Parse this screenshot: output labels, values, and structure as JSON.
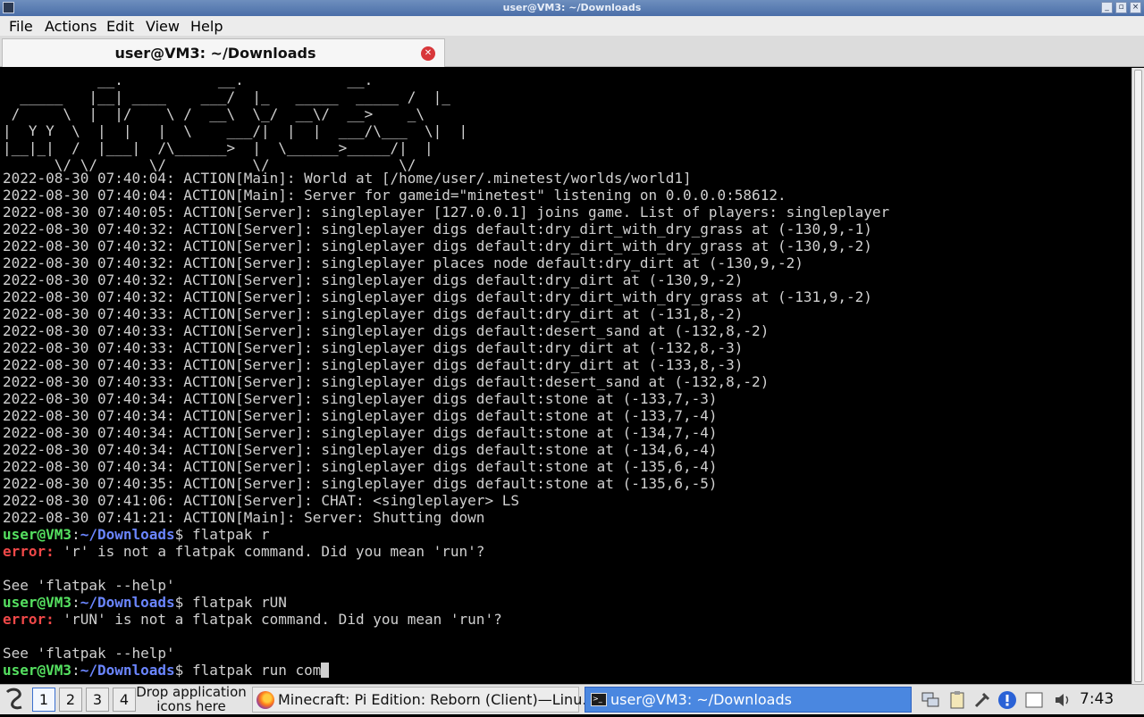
{
  "window": {
    "title": "user@VM3: ~/Downloads"
  },
  "menu": [
    "File",
    "Actions",
    "Edit",
    "View",
    "Help"
  ],
  "tab": {
    "label": "user@VM3: ~/Downloads"
  },
  "terminal": {
    "banner": [
      "           __.           __.            __.  ",
      "  _____   |__| ____    ___/  |_   _____  _____ /  |_ ",
      " /     \\  |  |/    \\ /  __\\  \\_/  __\\/  __>    _\\",
      "|  Y Y  \\  |  |   |  \\    ___/|  |  |  ___/\\___  \\|  |",
      "|__|_|  /  |___|  /\\______>  |  \\______>_____/|  |",
      "      \\/ \\/      \\/          \\/               \\/  "
    ],
    "log": [
      "2022-08-30 07:40:04: ACTION[Main]: World at [/home/user/.minetest/worlds/world1]",
      "2022-08-30 07:40:04: ACTION[Main]: Server for gameid=\"minetest\" listening on 0.0.0.0:58612.",
      "2022-08-30 07:40:05: ACTION[Server]: singleplayer [127.0.0.1] joins game. List of players: singleplayer",
      "2022-08-30 07:40:32: ACTION[Server]: singleplayer digs default:dry_dirt_with_dry_grass at (-130,9,-1)",
      "2022-08-30 07:40:32: ACTION[Server]: singleplayer digs default:dry_dirt_with_dry_grass at (-130,9,-2)",
      "2022-08-30 07:40:32: ACTION[Server]: singleplayer places node default:dry_dirt at (-130,9,-2)",
      "2022-08-30 07:40:32: ACTION[Server]: singleplayer digs default:dry_dirt at (-130,9,-2)",
      "2022-08-30 07:40:32: ACTION[Server]: singleplayer digs default:dry_dirt_with_dry_grass at (-131,9,-2)",
      "2022-08-30 07:40:33: ACTION[Server]: singleplayer digs default:dry_dirt at (-131,8,-2)",
      "2022-08-30 07:40:33: ACTION[Server]: singleplayer digs default:desert_sand at (-132,8,-2)",
      "2022-08-30 07:40:33: ACTION[Server]: singleplayer digs default:dry_dirt at (-132,8,-3)",
      "2022-08-30 07:40:33: ACTION[Server]: singleplayer digs default:dry_dirt at (-133,8,-3)",
      "2022-08-30 07:40:33: ACTION[Server]: singleplayer digs default:desert_sand at (-132,8,-2)",
      "2022-08-30 07:40:34: ACTION[Server]: singleplayer digs default:stone at (-133,7,-3)",
      "2022-08-30 07:40:34: ACTION[Server]: singleplayer digs default:stone at (-133,7,-4)",
      "2022-08-30 07:40:34: ACTION[Server]: singleplayer digs default:stone at (-134,7,-4)",
      "2022-08-30 07:40:34: ACTION[Server]: singleplayer digs default:stone at (-134,6,-4)",
      "2022-08-30 07:40:34: ACTION[Server]: singleplayer digs default:stone at (-135,6,-4)",
      "2022-08-30 07:40:35: ACTION[Server]: singleplayer digs default:stone at (-135,6,-5)",
      "2022-08-30 07:41:06: ACTION[Server]: CHAT: <singleplayer> LS",
      "2022-08-30 07:41:21: ACTION[Main]: Server: Shutting down"
    ],
    "prompt_user": "user@VM3",
    "prompt_sep": ":",
    "prompt_path": "~/Downloads",
    "prompt_dollar": "$ ",
    "error_label": "error:",
    "session": [
      {
        "command": "flatpak r",
        "error": " 'r' is not a flatpak command. Did you mean 'run'?",
        "hint": "See 'flatpak --help'"
      },
      {
        "command": "flatpak rUN",
        "error": " 'rUN' is not a flatpak command. Did you mean 'run'?",
        "hint": "See 'flatpak --help'"
      }
    ],
    "current_input": "flatpak run com"
  },
  "taskbar": {
    "workspaces": [
      "1",
      "2",
      "3",
      "4"
    ],
    "drop_text_1": "Drop application",
    "drop_text_2": "icons here",
    "tasks": [
      {
        "label": "Minecraft: Pi Edition: Reborn (Client)—Linu…",
        "icon": "firefox-icon",
        "active": false
      },
      {
        "label": "user@VM3: ~/Downloads",
        "icon": "terminal-icon",
        "active": true
      }
    ],
    "clock": "7:43"
  },
  "colors": {
    "prompt_user": "#55e060",
    "prompt_path": "#6b86ff",
    "error": "#f04848",
    "active_task": "#4a87e0"
  }
}
